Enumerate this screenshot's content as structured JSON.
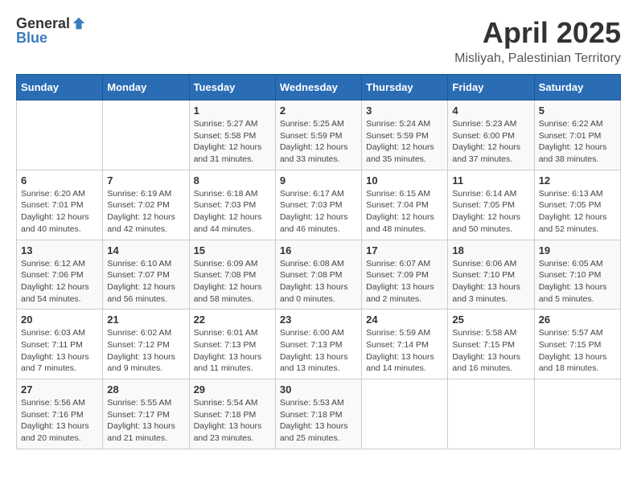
{
  "header": {
    "logo_general": "General",
    "logo_blue": "Blue",
    "title": "April 2025",
    "subtitle": "Misliyah, Palestinian Territory"
  },
  "days_of_week": [
    "Sunday",
    "Monday",
    "Tuesday",
    "Wednesday",
    "Thursday",
    "Friday",
    "Saturday"
  ],
  "weeks": [
    [
      {
        "day": "",
        "info": ""
      },
      {
        "day": "",
        "info": ""
      },
      {
        "day": "1",
        "info": "Sunrise: 5:27 AM\nSunset: 5:58 PM\nDaylight: 12 hours\nand 31 minutes."
      },
      {
        "day": "2",
        "info": "Sunrise: 5:25 AM\nSunset: 5:59 PM\nDaylight: 12 hours\nand 33 minutes."
      },
      {
        "day": "3",
        "info": "Sunrise: 5:24 AM\nSunset: 5:59 PM\nDaylight: 12 hours\nand 35 minutes."
      },
      {
        "day": "4",
        "info": "Sunrise: 5:23 AM\nSunset: 6:00 PM\nDaylight: 12 hours\nand 37 minutes."
      },
      {
        "day": "5",
        "info": "Sunrise: 6:22 AM\nSunset: 7:01 PM\nDaylight: 12 hours\nand 38 minutes."
      }
    ],
    [
      {
        "day": "6",
        "info": "Sunrise: 6:20 AM\nSunset: 7:01 PM\nDaylight: 12 hours\nand 40 minutes."
      },
      {
        "day": "7",
        "info": "Sunrise: 6:19 AM\nSunset: 7:02 PM\nDaylight: 12 hours\nand 42 minutes."
      },
      {
        "day": "8",
        "info": "Sunrise: 6:18 AM\nSunset: 7:03 PM\nDaylight: 12 hours\nand 44 minutes."
      },
      {
        "day": "9",
        "info": "Sunrise: 6:17 AM\nSunset: 7:03 PM\nDaylight: 12 hours\nand 46 minutes."
      },
      {
        "day": "10",
        "info": "Sunrise: 6:15 AM\nSunset: 7:04 PM\nDaylight: 12 hours\nand 48 minutes."
      },
      {
        "day": "11",
        "info": "Sunrise: 6:14 AM\nSunset: 7:05 PM\nDaylight: 12 hours\nand 50 minutes."
      },
      {
        "day": "12",
        "info": "Sunrise: 6:13 AM\nSunset: 7:05 PM\nDaylight: 12 hours\nand 52 minutes."
      }
    ],
    [
      {
        "day": "13",
        "info": "Sunrise: 6:12 AM\nSunset: 7:06 PM\nDaylight: 12 hours\nand 54 minutes."
      },
      {
        "day": "14",
        "info": "Sunrise: 6:10 AM\nSunset: 7:07 PM\nDaylight: 12 hours\nand 56 minutes."
      },
      {
        "day": "15",
        "info": "Sunrise: 6:09 AM\nSunset: 7:08 PM\nDaylight: 12 hours\nand 58 minutes."
      },
      {
        "day": "16",
        "info": "Sunrise: 6:08 AM\nSunset: 7:08 PM\nDaylight: 13 hours\nand 0 minutes."
      },
      {
        "day": "17",
        "info": "Sunrise: 6:07 AM\nSunset: 7:09 PM\nDaylight: 13 hours\nand 2 minutes."
      },
      {
        "day": "18",
        "info": "Sunrise: 6:06 AM\nSunset: 7:10 PM\nDaylight: 13 hours\nand 3 minutes."
      },
      {
        "day": "19",
        "info": "Sunrise: 6:05 AM\nSunset: 7:10 PM\nDaylight: 13 hours\nand 5 minutes."
      }
    ],
    [
      {
        "day": "20",
        "info": "Sunrise: 6:03 AM\nSunset: 7:11 PM\nDaylight: 13 hours\nand 7 minutes."
      },
      {
        "day": "21",
        "info": "Sunrise: 6:02 AM\nSunset: 7:12 PM\nDaylight: 13 hours\nand 9 minutes."
      },
      {
        "day": "22",
        "info": "Sunrise: 6:01 AM\nSunset: 7:13 PM\nDaylight: 13 hours\nand 11 minutes."
      },
      {
        "day": "23",
        "info": "Sunrise: 6:00 AM\nSunset: 7:13 PM\nDaylight: 13 hours\nand 13 minutes."
      },
      {
        "day": "24",
        "info": "Sunrise: 5:59 AM\nSunset: 7:14 PM\nDaylight: 13 hours\nand 14 minutes."
      },
      {
        "day": "25",
        "info": "Sunrise: 5:58 AM\nSunset: 7:15 PM\nDaylight: 13 hours\nand 16 minutes."
      },
      {
        "day": "26",
        "info": "Sunrise: 5:57 AM\nSunset: 7:15 PM\nDaylight: 13 hours\nand 18 minutes."
      }
    ],
    [
      {
        "day": "27",
        "info": "Sunrise: 5:56 AM\nSunset: 7:16 PM\nDaylight: 13 hours\nand 20 minutes."
      },
      {
        "day": "28",
        "info": "Sunrise: 5:55 AM\nSunset: 7:17 PM\nDaylight: 13 hours\nand 21 minutes."
      },
      {
        "day": "29",
        "info": "Sunrise: 5:54 AM\nSunset: 7:18 PM\nDaylight: 13 hours\nand 23 minutes."
      },
      {
        "day": "30",
        "info": "Sunrise: 5:53 AM\nSunset: 7:18 PM\nDaylight: 13 hours\nand 25 minutes."
      },
      {
        "day": "",
        "info": ""
      },
      {
        "day": "",
        "info": ""
      },
      {
        "day": "",
        "info": ""
      }
    ]
  ]
}
